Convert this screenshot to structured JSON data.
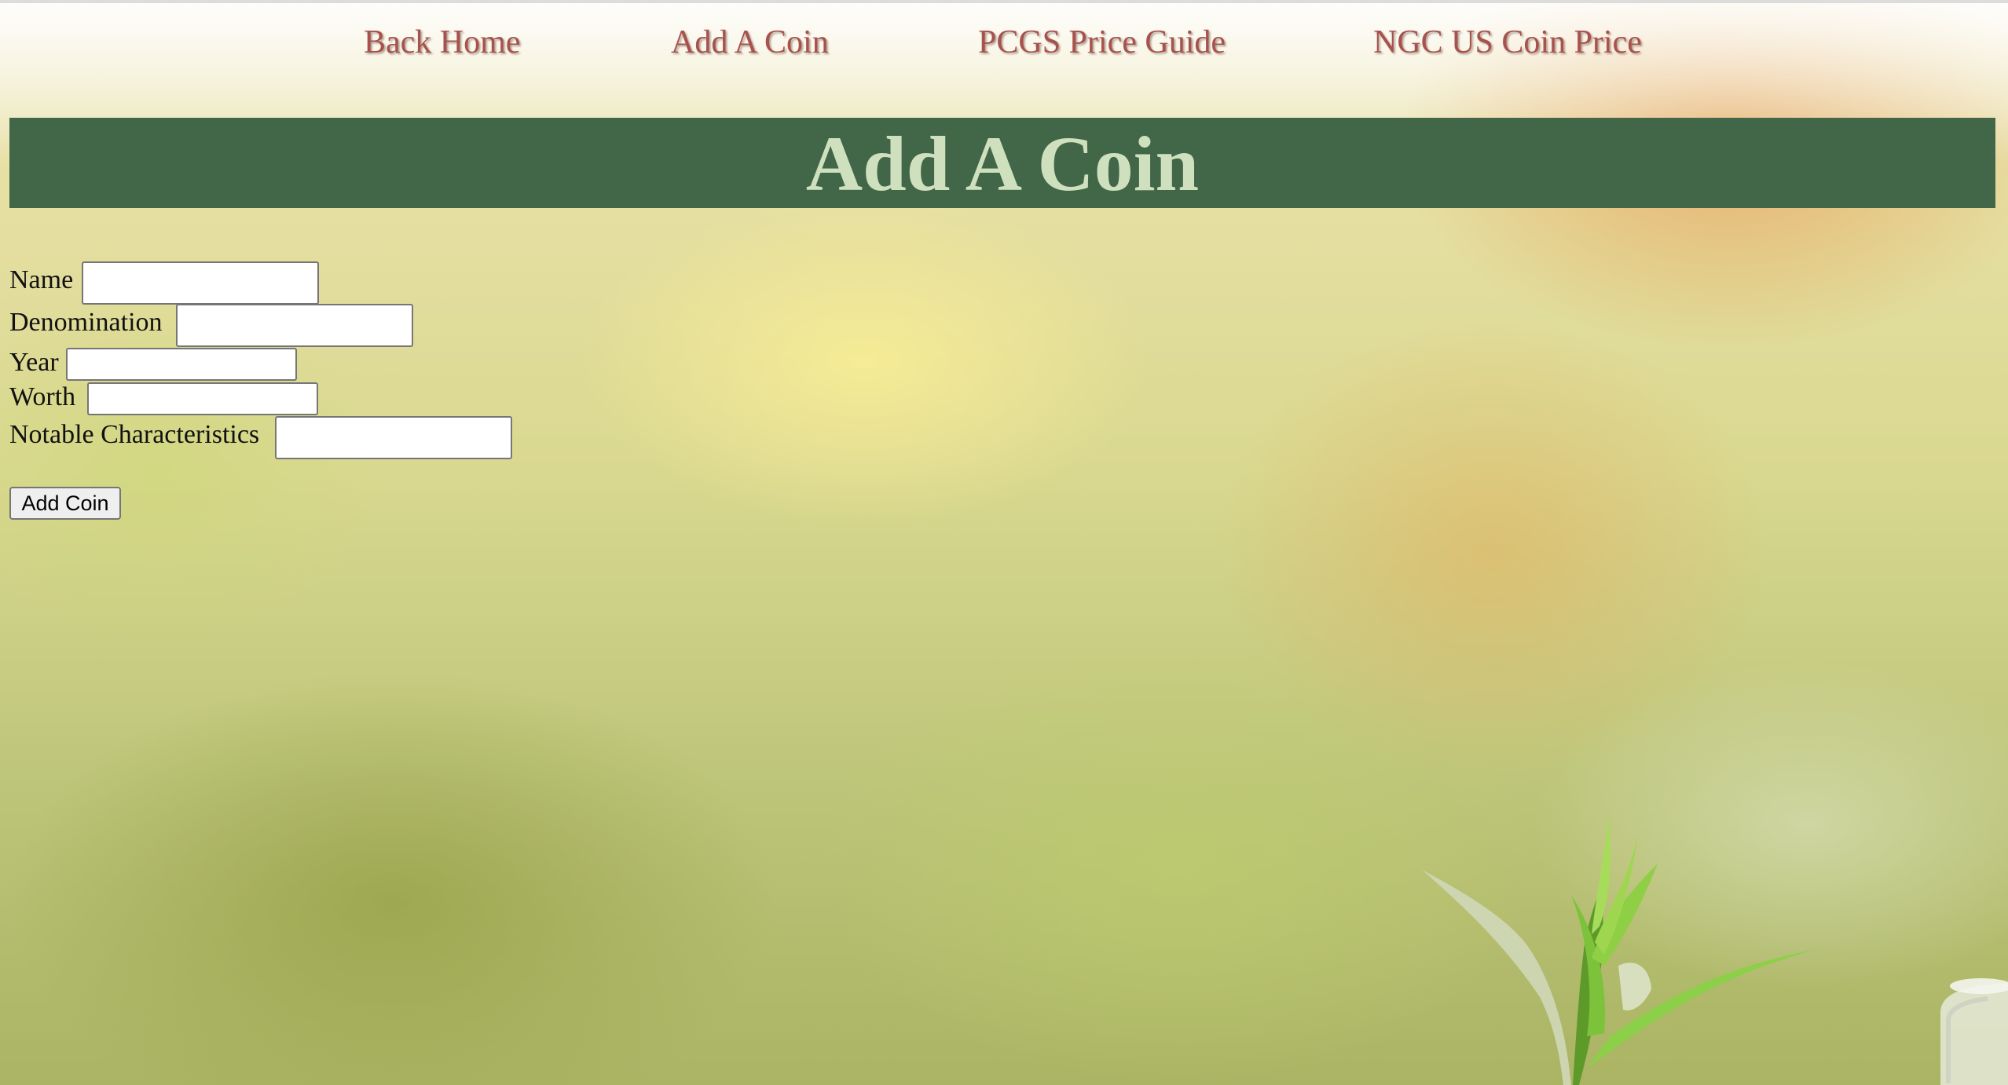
{
  "nav": {
    "links": [
      {
        "label": "Back Home"
      },
      {
        "label": "Add A Coin"
      },
      {
        "label": "PCGS Price Guide"
      },
      {
        "label": "NGC US Coin Price"
      }
    ]
  },
  "header": {
    "title": "Add A Coin"
  },
  "form": {
    "fields": [
      {
        "label": "Name",
        "value": ""
      },
      {
        "label": "Denomination",
        "value": ""
      },
      {
        "label": "Year",
        "value": ""
      },
      {
        "label": "Worth",
        "value": ""
      },
      {
        "label": "Notable Characteristics",
        "value": ""
      }
    ],
    "submit_label": "Add Coin"
  },
  "colors": {
    "nav_link": "#a8514d",
    "banner_bg": "#426748",
    "banner_text": "#cfe0be"
  },
  "decorations": {
    "background_image": "blurred-garden-background",
    "plant": "seedling-icon",
    "jar": "glass-jar-icon"
  }
}
